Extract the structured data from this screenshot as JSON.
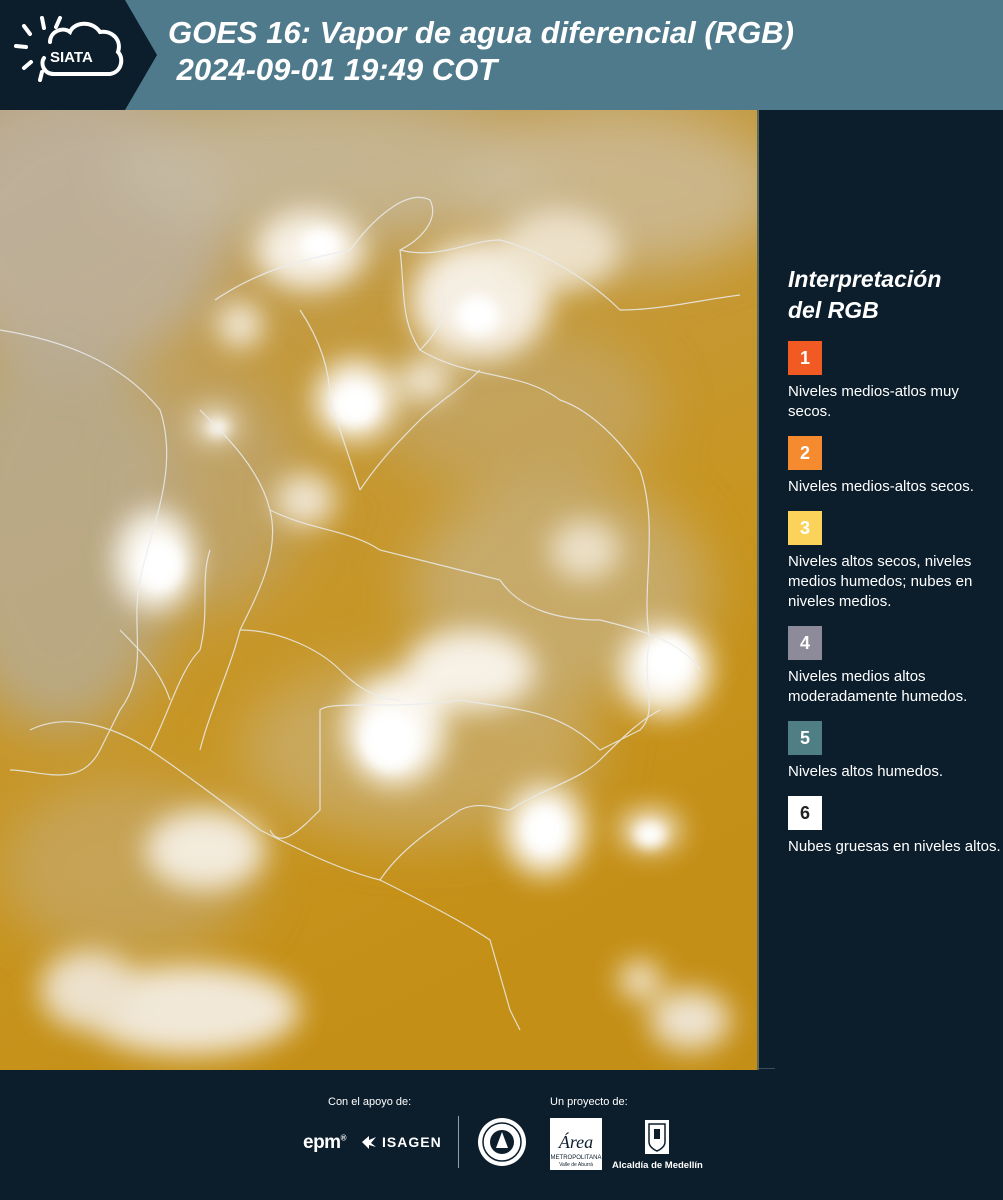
{
  "header": {
    "logo_text": "SIATA",
    "title_line1": "GOES 16: Vapor de agua diferencial (RGB)",
    "title_line2": " 2024-09-01 19:49 COT"
  },
  "legend": {
    "title_line1": "Interpretación",
    "title_line2": "del RGB",
    "items": [
      {
        "number": "1",
        "color": "#f15a22",
        "text": "Niveles medios-atlos muy secos."
      },
      {
        "number": "2",
        "color": "#f58a2e",
        "text": "Niveles medios-altos secos."
      },
      {
        "number": "3",
        "color": "#fbd25a",
        "text": "Niveles altos secos, niveles medios humedos; nubes en niveles medios."
      },
      {
        "number": "4",
        "color": "#8d8a99",
        "text": "Niveles medios altos moderadamente humedos."
      },
      {
        "number": "5",
        "color": "#4f7f84",
        "text": "Niveles altos humedos."
      },
      {
        "number": "6",
        "color": "#ffffff",
        "text": "Nubes gruesas en niveles altos."
      }
    ]
  },
  "footer": {
    "support_label": "Con el apoyo de:",
    "project_label": "Un proyecto de:",
    "epm_text": "epm",
    "isagen_text": "ISAGEN",
    "area_text": "Área",
    "area_sub": "METROPOLITANA",
    "area_sub2": "Valle de Aburrá",
    "alcaldia_text": "Alcaldía de Medellín"
  },
  "colors": {
    "background": "#0c1e2c",
    "header_band": "#4e7a8b",
    "dry_mid_level": "#c2962e"
  },
  "icons": [
    "sun-cloud-icon",
    "isagen-icon",
    "city-seal-icon",
    "area-metropolitana-icon",
    "alcaldia-shield-icon"
  ]
}
